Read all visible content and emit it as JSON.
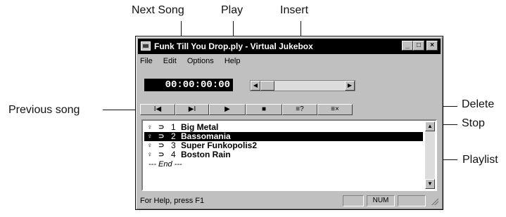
{
  "callouts": {
    "next_song": "Next Song",
    "play": "Play",
    "insert": "Insert",
    "previous_song": "Previous song",
    "delete": "Delete",
    "stop": "Stop",
    "playlist": "Playlist"
  },
  "window": {
    "title": "Funk Till You Drop.ply - Virtual Jukebox",
    "title_buttons": [
      "_",
      "□",
      "×"
    ],
    "menu": [
      "File",
      "Edit",
      "Options",
      "Help"
    ],
    "counter": "00:00:00:00",
    "toolbar": {
      "prev": "I◀",
      "next": "▶I",
      "play": "▶",
      "stop": "■",
      "insert": "≡?",
      "delete": "≡×"
    },
    "playlist": [
      {
        "num": "1",
        "name": "Big Metal",
        "selected": false
      },
      {
        "num": "2",
        "name": "Bassomania",
        "selected": true
      },
      {
        "num": "3",
        "name": "Super Funkopolis2",
        "selected": false
      },
      {
        "num": "4",
        "name": "Boston Rain",
        "selected": false
      }
    ],
    "end_marker": "--- End ---",
    "status_text": "For Help, press F1",
    "status_num": "NUM"
  },
  "icons": {
    "row_icon": "speaker-icon",
    "row_icon2": "link-icon"
  }
}
